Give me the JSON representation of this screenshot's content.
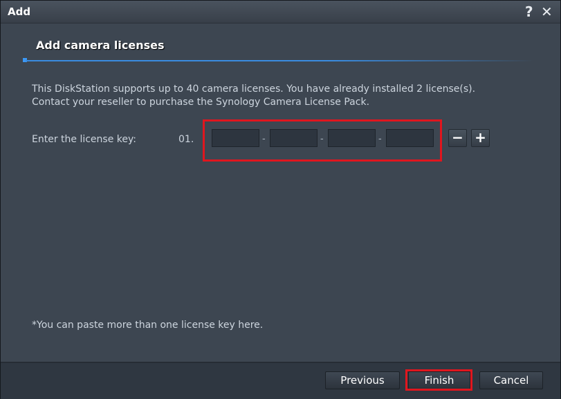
{
  "window": {
    "title": "Add",
    "help_icon": "?",
    "close_icon": "✕"
  },
  "section": {
    "title": "Add camera licenses"
  },
  "description": {
    "line1": "This DiskStation supports up to 40 camera licenses. You have already installed 2 license(s).",
    "line2": "Contact your reseller to purchase the Synology Camera License Pack."
  },
  "license": {
    "label": "Enter the license key:",
    "row_number": "01.",
    "fields": [
      {
        "value": "",
        "placeholder": ""
      },
      {
        "value": "",
        "placeholder": ""
      },
      {
        "value": "",
        "placeholder": ""
      },
      {
        "value": "",
        "placeholder": ""
      }
    ],
    "separator": "-",
    "remove_label": "−",
    "add_label": "+"
  },
  "note": "*You can paste more than one license key here.",
  "footer": {
    "previous_label": "Previous",
    "finish_label": "Finish",
    "cancel_label": "Cancel"
  },
  "colors": {
    "accent": "#3a8ce0",
    "highlight": "#e0161e",
    "background": "#3d4651"
  }
}
